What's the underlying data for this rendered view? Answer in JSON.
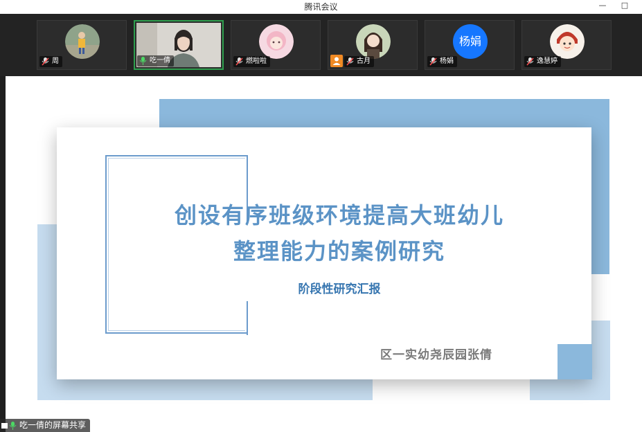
{
  "window": {
    "title": "腾讯会议",
    "minimize": "—",
    "maximize": "□"
  },
  "participants": [
    {
      "name": "周",
      "mic": "muted",
      "avatar": "photo-child"
    },
    {
      "name": "吃一倩",
      "mic": "speaking",
      "avatar": "camera-video"
    },
    {
      "name": "燃啦啦",
      "mic": "muted",
      "avatar": "photo-girl"
    },
    {
      "name": "古月",
      "mic": "muted",
      "avatar": "photo-cartoon",
      "host_badge": "person-icon"
    },
    {
      "name": "杨娟",
      "mic": "muted",
      "avatar_text": "杨娟"
    },
    {
      "name": "逸慧婷",
      "mic": "muted",
      "avatar": "photo-cartoon-boy"
    }
  ],
  "slide": {
    "title_line1": "创设有序班级环境提高大班幼儿",
    "title_line2": "整理能力的案例研究",
    "subtitle": "阶段性研究汇报",
    "author": "区一实幼尧辰园张倩"
  },
  "share_label": "吃一倩的屏幕共享",
  "colors": {
    "accent_blue": "#5b93c6",
    "panel_blue": "#8bb8dc",
    "light_blue": "#c6dcef",
    "speaking_green": "#2e9e4d",
    "avatar_blue": "#1677ff"
  }
}
